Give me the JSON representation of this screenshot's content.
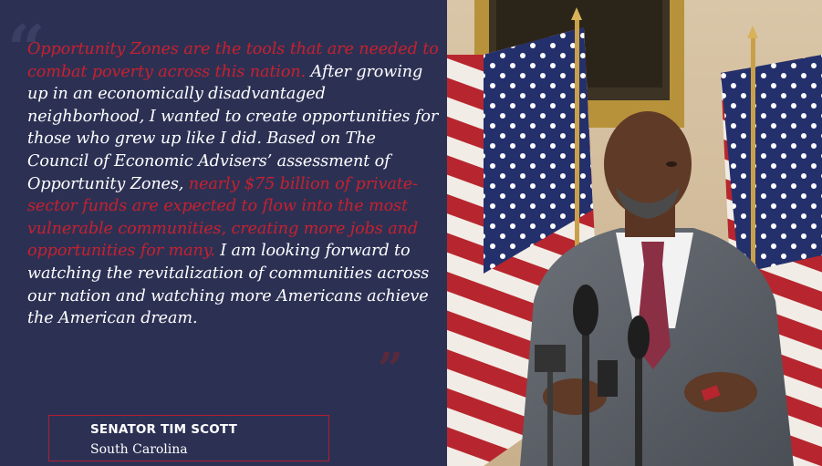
{
  "quote": {
    "segments": [
      {
        "text": "Opportunity Zones are the tools that are needed to combat poverty across this nation.",
        "color": "#c8202e"
      },
      {
        "text": " After growing up in an economically disadvantaged neighborhood, I wanted to create opportunities for those who grew up like I did. Based on The Council of Economic Advisers’ assessment of Opportunity Zones, ",
        "color": "#ffffff"
      },
      {
        "text": "nearly $75 billion of private-sector funds are expected to flow into the most vulnerable communities, creating more jobs and opportunities for many.",
        "color": "#c8202e"
      },
      {
        "text": " I am looking forward to watching the revitalization of communities across our nation and watching more Americans achieve the American dream.",
        "color": "#ffffff"
      }
    ]
  },
  "attribution": {
    "name": "SENATOR TIM SCOTT",
    "state": "South Carolina"
  },
  "colors": {
    "panel_bg": "#2c3154",
    "accent_red": "#c8202e",
    "text_white": "#ffffff"
  },
  "icons": {
    "open_quote": "open-quote-icon",
    "close_quote": "close-quote-icon"
  }
}
